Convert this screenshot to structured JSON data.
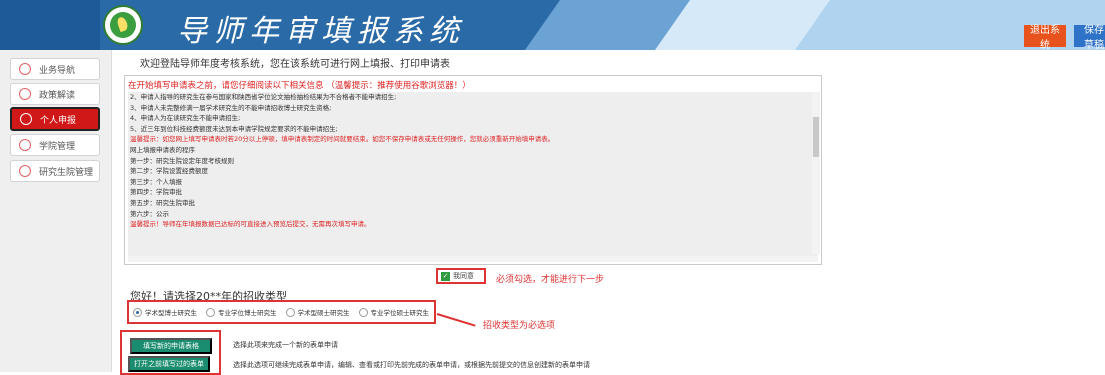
{
  "header": {
    "title": "导师年审填报系统",
    "logout_label": "退出系统",
    "save_label": "保存草稿",
    "colors": {
      "dark": "#2a6aa7",
      "light": "#b0d4f0",
      "logout": "#e8531d",
      "save": "#2f73c8"
    }
  },
  "sidebar": {
    "items": [
      {
        "label": "业务导航",
        "active": false
      },
      {
        "label": "政策解读",
        "active": false
      },
      {
        "label": "个人申报",
        "active": true
      },
      {
        "label": "学院管理",
        "active": false
      },
      {
        "label": "研究生院管理",
        "active": false
      }
    ]
  },
  "main": {
    "welcome": "欢迎登陆导师年度考核系统，您在该系统可进行网上填报、打印申请表",
    "notice_heading": "在开始填写申请表之前，请您仔细阅读以下相关信息 （温馨提示：推荐使用谷歌浏览器！）",
    "notice_lines": [
      {
        "text": "2、申请人指导的研究生在参与国家和陕西省学位论文抽检抽检结果为不合格者不能申请招生;",
        "red": false
      },
      {
        "text": "3、申请人未完整修满一届学术研究生的不能申请招收博士研究生资格;",
        "red": false
      },
      {
        "text": "4、申请人为在读研究生不能申请招生;",
        "red": false
      },
      {
        "text": "5、近三年到位科技经费额度未达到本申请学院规定要求的不能申请招生;",
        "red": false
      },
      {
        "text": "温馨提示：如您网上填写申请表时若20分以上停顿，填申请表制定的时间就要结束。如您不保存申请表或无任何操作，您就必须重新开始填申请表。",
        "red": true
      },
      {
        "text": "网上填报申请表的程序",
        "red": false
      },
      {
        "text": "第一步：研究生院设定年度考核规则",
        "red": false
      },
      {
        "text": "第二步：学院设置经费额度",
        "red": false
      },
      {
        "text": "第三步：个人填报",
        "red": false
      },
      {
        "text": "第四步：学院审批",
        "red": false
      },
      {
        "text": "第五步：研究生院审批",
        "red": false
      },
      {
        "text": "第六步：公示",
        "red": false
      },
      {
        "text": "温馨提示！导师在年填报数据已达标的可直接进入预览后提交，无需再次填写申请。",
        "red": true
      }
    ],
    "agree_label": "我同意",
    "agree_checked": true,
    "agree_hint": "必须勾选，才能进行下一步",
    "type_title": "您好！请选择20**年的招收类型",
    "type_options": [
      {
        "label": "学术型博士研究生",
        "checked": true
      },
      {
        "label": "专业学位博士研究生",
        "checked": false
      },
      {
        "label": "学术型硕士研究生",
        "checked": false
      },
      {
        "label": "专业学位硕士研究生",
        "checked": false
      }
    ],
    "type_hint": "招收类型为必选项",
    "actions": [
      {
        "label": "填写新的申请表格",
        "desc": "选择此项来完成一个新的表单申请"
      },
      {
        "label": "打开之前填写过的表单",
        "desc": "选择此选项可继续完成表单申请，编辑、查看或打印先前完成的表单申请，或根据先前提交的信息创建新的表单申请"
      }
    ]
  }
}
